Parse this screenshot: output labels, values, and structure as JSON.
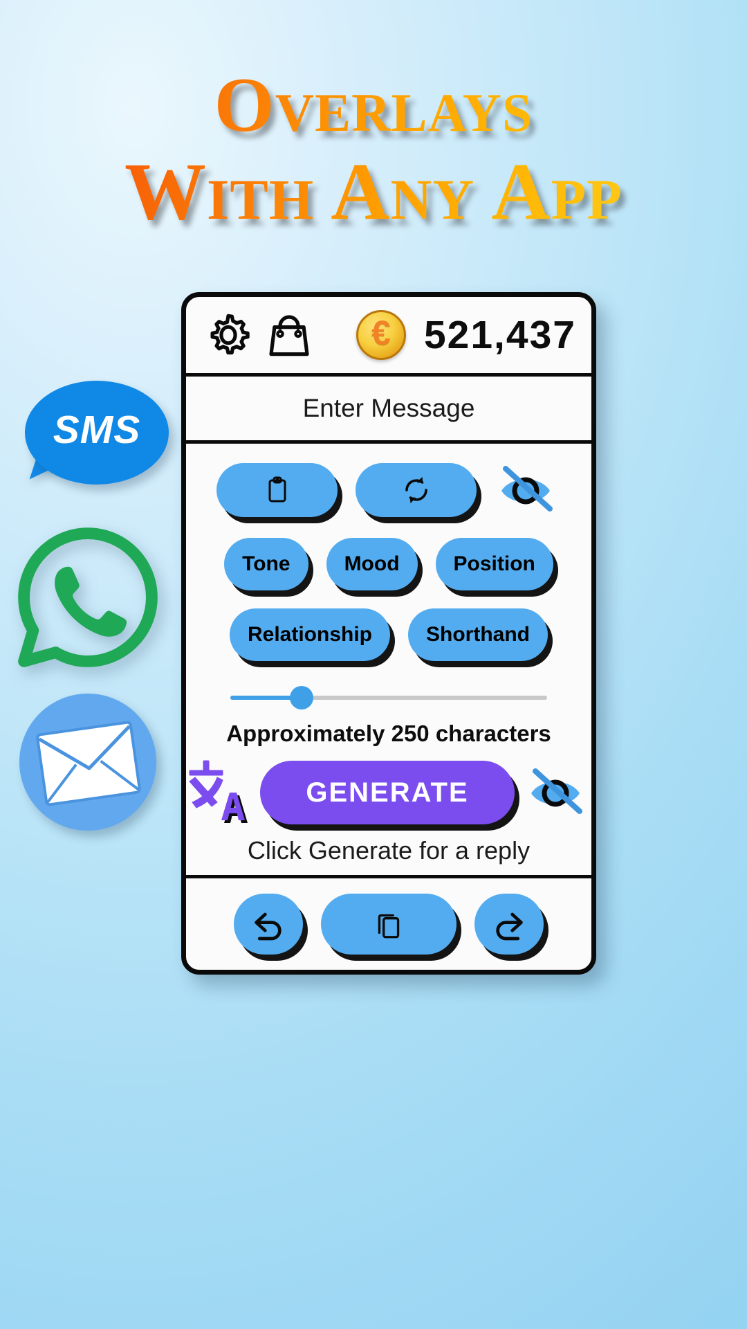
{
  "headline": {
    "line1": "Overlays",
    "line2": "With Any App",
    "gradient_start": "#f4520a",
    "gradient_end": "#ffd92a"
  },
  "side_icons": [
    {
      "name": "sms",
      "label": "SMS",
      "color": "#1089e6"
    },
    {
      "name": "whatsapp",
      "label": "WhatsApp",
      "color": "#1fa855"
    },
    {
      "name": "email",
      "label": "Email",
      "color": "#62a8ef"
    }
  ],
  "phone": {
    "topbar": {
      "settings_icon": "gear-icon",
      "store_icon": "shopping-bag-icon",
      "coin_icon": "coin-icon",
      "coin_symbol": "€",
      "coin_count": "521,437"
    },
    "message_field": {
      "placeholder": "Enter Message",
      "value": ""
    },
    "actions": [
      {
        "name": "paste",
        "icon": "clipboard-icon"
      },
      {
        "name": "regenerate",
        "icon": "refresh-icon"
      }
    ],
    "visibility_toggle_top": "eye-off-icon",
    "chips_row1": [
      {
        "label": "Tone"
      },
      {
        "label": "Mood"
      },
      {
        "label": "Position"
      }
    ],
    "chips_row2": [
      {
        "label": "Relationship"
      },
      {
        "label": "Shorthand"
      }
    ],
    "slider": {
      "value_percent": 20,
      "caption": "Approximately 250 characters",
      "track_color": "#c9c9c9",
      "fill_color": "#3fa0e8"
    },
    "generate": {
      "translate_icon": "translate-icon",
      "label": "GENERATE",
      "color": "#7c4dee",
      "visibility_toggle": "eye-off-icon"
    },
    "reply_hint": "Click Generate for a reply",
    "bottombar": [
      {
        "name": "undo",
        "icon": "undo-icon"
      },
      {
        "name": "copy",
        "icon": "copy-icon"
      },
      {
        "name": "redo",
        "icon": "redo-icon"
      }
    ],
    "accent_blue": "#53acef"
  }
}
